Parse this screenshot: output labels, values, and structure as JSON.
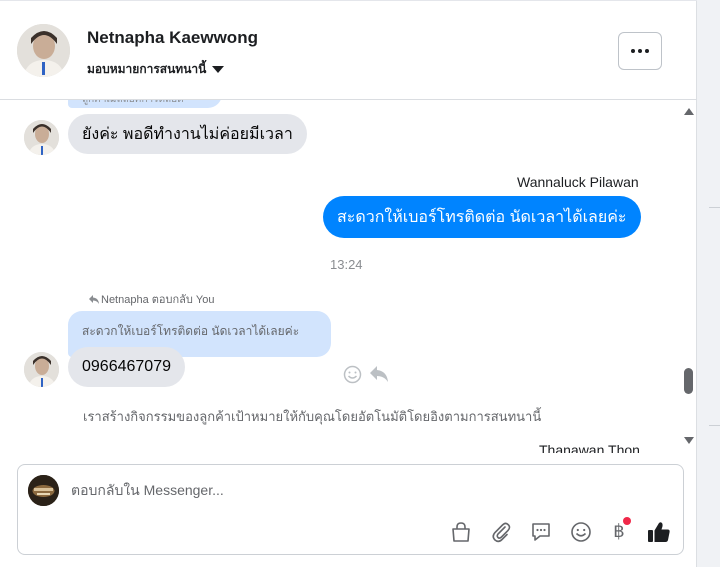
{
  "header": {
    "contact_name": "Netnapha Kaewwong",
    "assign_label": "มอบหมายการสนทนานี้"
  },
  "thread": {
    "cut_quote_text": "ลูกค้าเมลลอคการตลอด",
    "msg1": "ยังค่ะ พอดีทำงานไม่ค่อยมีเวลา",
    "sender_wannaluck": "Wannaluck Pilawan",
    "msg2": "สะดวกให้เบอร์โทรติดต่อ นัดเวลาได้เลยค่ะ",
    "timestamp": "13:24",
    "reply_meta": "Netnapha ตอบกลับ You",
    "quoted_text": "สะดวกให้เบอร์โทรติดต่อ นัดเวลาได้เลยค่ะ",
    "msg3": "0966467079",
    "system_note": "เราสร้างกิจกรรมของลูกค้าเป้าหมายให้กับคุณโดยอัตโนมัติโดยอิงตามการสนทนานี้",
    "sender_thanawan": "Thanawan Thon"
  },
  "composer": {
    "placeholder": "ตอบกลับใน Messenger..."
  },
  "colors": {
    "outgoing_bubble": "#0084ff",
    "incoming_bubble": "#e4e6eb",
    "quote_bubble": "#d2e4fd",
    "notification_dot": "#f02849"
  },
  "icons": [
    "more-icon",
    "caret-down-icon",
    "smile-react-icon",
    "reply-arrow-icon",
    "shopping-bag-icon",
    "paperclip-icon",
    "saved-reply-icon",
    "emoji-icon",
    "baht-payment-icon",
    "thumbs-up-icon"
  ]
}
